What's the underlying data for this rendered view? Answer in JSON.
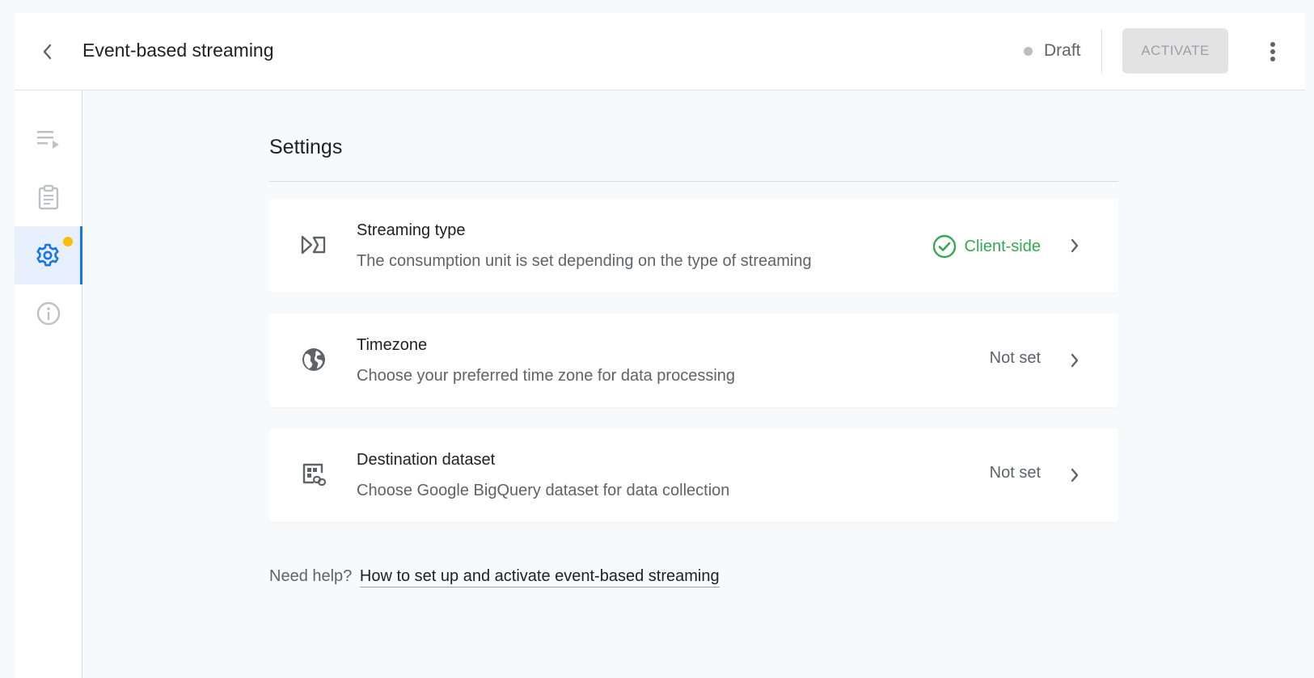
{
  "header": {
    "title": "Event-based streaming",
    "status": "Draft",
    "activate_label": "ACTIVATE"
  },
  "sidebar": {
    "items": [
      {
        "icon": "playlist-icon"
      },
      {
        "icon": "clipboard-icon"
      },
      {
        "icon": "settings-gear-icon",
        "active": true,
        "notification": true
      },
      {
        "icon": "info-icon"
      }
    ]
  },
  "main": {
    "section_title": "Settings",
    "cards": [
      {
        "icon": "streaming-type-icon",
        "title": "Streaming type",
        "description": "The consumption unit is set depending on the type of streaming",
        "value": "Client-side",
        "status": "ok"
      },
      {
        "icon": "globe-icon",
        "title": "Timezone",
        "description": "Choose your preferred time zone for data processing",
        "value": "Not set"
      },
      {
        "icon": "dataset-link-icon",
        "title": "Destination dataset",
        "description": "Choose Google BigQuery dataset for data collection",
        "value": "Not set"
      }
    ],
    "help": {
      "prefix": "Need help?",
      "link_text": "How to set up and activate event-based streaming"
    }
  },
  "colors": {
    "accent": "#1a73e8",
    "success": "#34a853",
    "notification": "#fbbc04"
  }
}
